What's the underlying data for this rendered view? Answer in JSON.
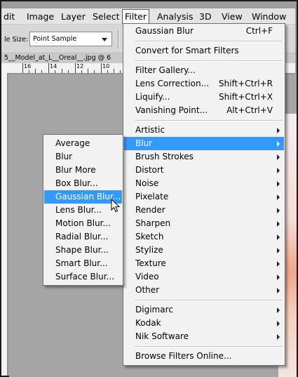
{
  "menubar": {
    "items": [
      "dit",
      "Image",
      "Layer",
      "Select",
      "Filter",
      "Analysis",
      "3D",
      "View",
      "Window"
    ],
    "active": "Filter"
  },
  "options": {
    "sample_label": "le Size:",
    "sample_value": "Point Sample"
  },
  "document": {
    "tab_title": "5__Model_at_L__Oreal__.jpg @ 6"
  },
  "ruler": {
    "labels": [
      "16",
      "14",
      "12",
      "10"
    ]
  },
  "filter_menu": {
    "groups": [
      [
        {
          "label": "Gaussian Blur",
          "shortcut": "Ctrl+F"
        }
      ],
      [
        {
          "label": "Convert for Smart Filters"
        }
      ],
      [
        {
          "label": "Filter Gallery..."
        },
        {
          "label": "Lens Correction...",
          "shortcut": "Shift+Ctrl+R"
        },
        {
          "label": "Liquify...",
          "shortcut": "Shift+Ctrl+X"
        },
        {
          "label": "Vanishing Point...",
          "shortcut": "Alt+Ctrl+V"
        }
      ],
      [
        {
          "label": "Artistic",
          "submenu": true
        },
        {
          "label": "Blur",
          "submenu": true,
          "highlighted": true
        },
        {
          "label": "Brush Strokes",
          "submenu": true
        },
        {
          "label": "Distort",
          "submenu": true
        },
        {
          "label": "Noise",
          "submenu": true
        },
        {
          "label": "Pixelate",
          "submenu": true
        },
        {
          "label": "Render",
          "submenu": true
        },
        {
          "label": "Sharpen",
          "submenu": true
        },
        {
          "label": "Sketch",
          "submenu": true
        },
        {
          "label": "Stylize",
          "submenu": true
        },
        {
          "label": "Texture",
          "submenu": true
        },
        {
          "label": "Video",
          "submenu": true
        },
        {
          "label": "Other",
          "submenu": true
        }
      ],
      [
        {
          "label": "Digimarc",
          "submenu": true
        },
        {
          "label": "Kodak",
          "submenu": true
        },
        {
          "label": "Nik Software",
          "submenu": true
        }
      ],
      [
        {
          "label": "Browse Filters Online..."
        }
      ]
    ]
  },
  "blur_submenu": {
    "items": [
      "Average",
      "Blur",
      "Blur More",
      "Box Blur...",
      "Gaussian Blur...",
      "Lens Blur...",
      "Motion Blur...",
      "Radial Blur...",
      "Shape Blur...",
      "Smart Blur...",
      "Surface Blur..."
    ],
    "highlighted": "Gaussian Blur..."
  },
  "colors": {
    "highlight": "#3399ff",
    "menu_bg": "#f2f2f2"
  }
}
